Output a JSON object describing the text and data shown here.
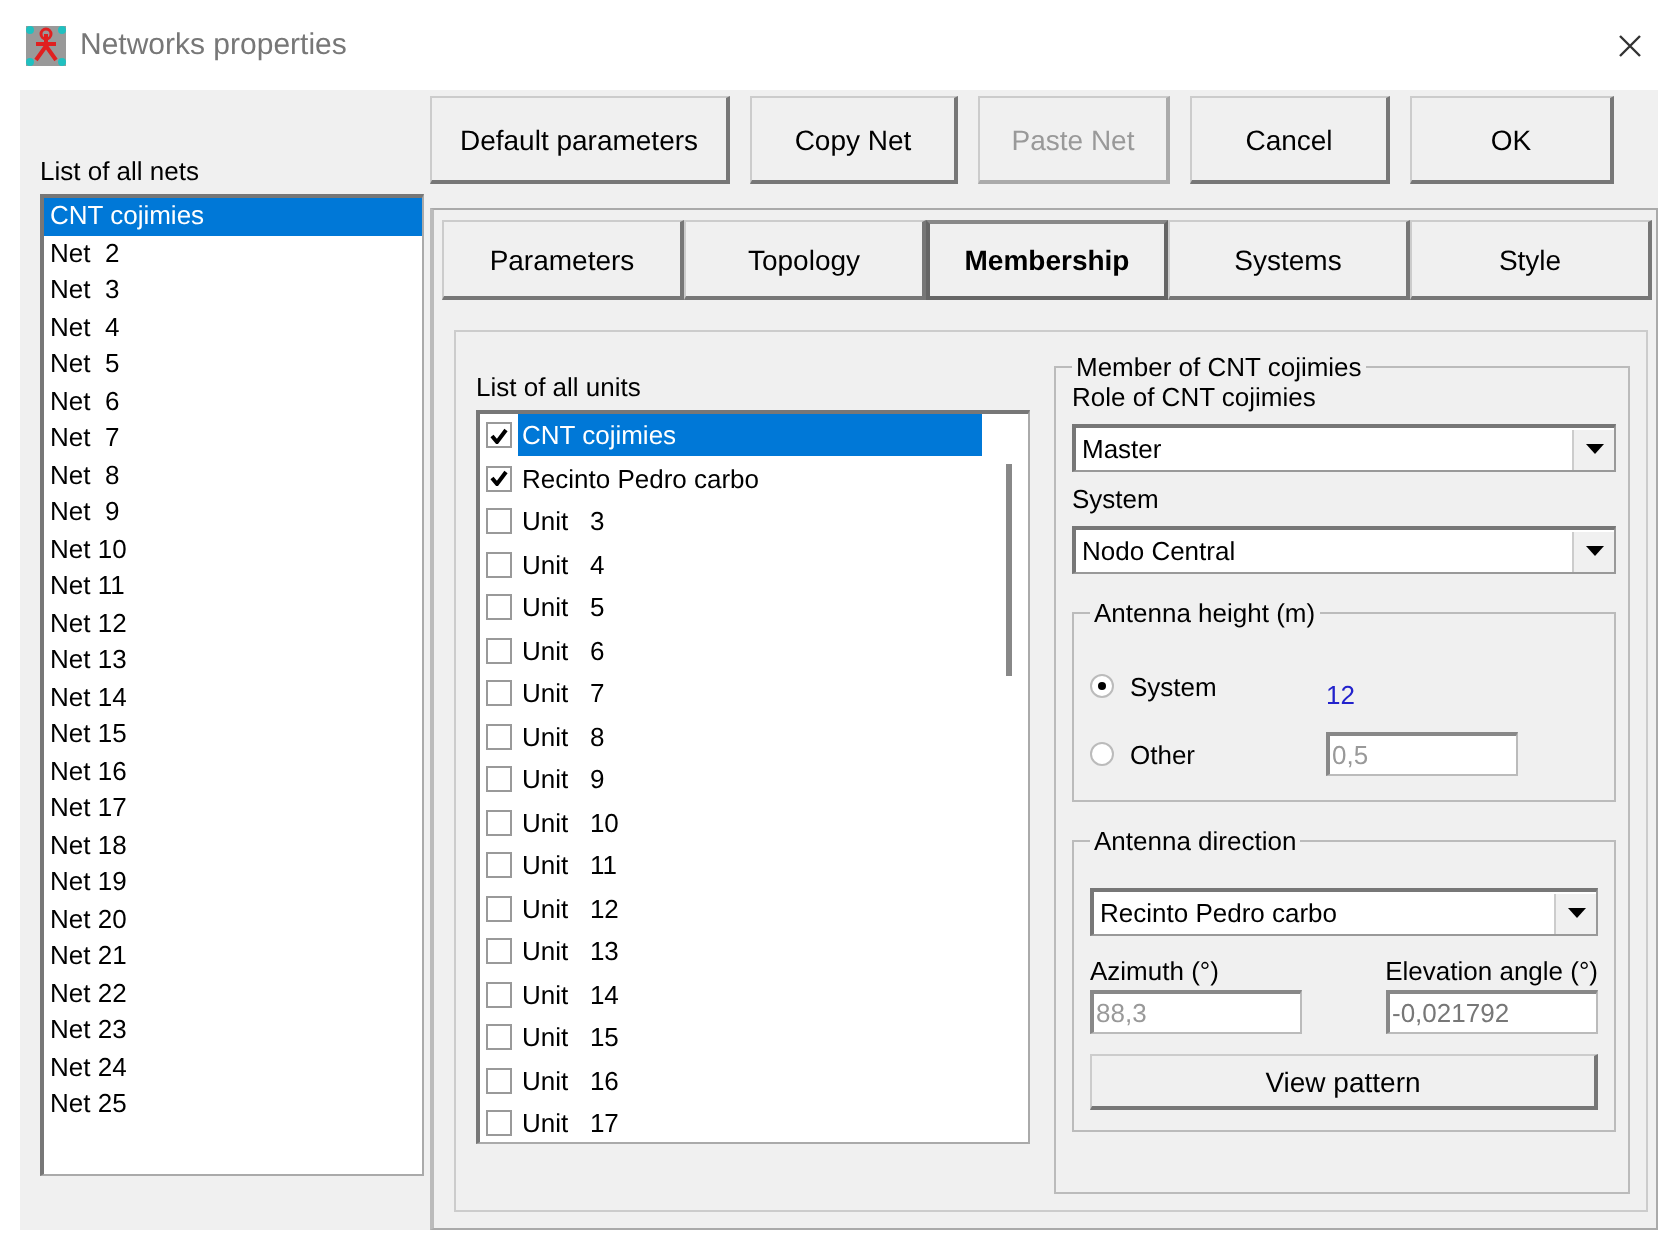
{
  "window": {
    "title": "Networks properties"
  },
  "buttons": [
    {
      "label": "Default parameters",
      "disabled": false
    },
    {
      "label": "Copy Net",
      "disabled": false
    },
    {
      "label": "Paste Net",
      "disabled": true
    },
    {
      "label": "Cancel",
      "disabled": false
    },
    {
      "label": "OK",
      "disabled": false
    }
  ],
  "nets": {
    "label": "List of all nets",
    "items": [
      {
        "label": "CNT cojimies",
        "selected": true
      },
      {
        "label": "Net  2",
        "selected": false
      },
      {
        "label": "Net  3",
        "selected": false
      },
      {
        "label": "Net  4",
        "selected": false
      },
      {
        "label": "Net  5",
        "selected": false
      },
      {
        "label": "Net  6",
        "selected": false
      },
      {
        "label": "Net  7",
        "selected": false
      },
      {
        "label": "Net  8",
        "selected": false
      },
      {
        "label": "Net  9",
        "selected": false
      },
      {
        "label": "Net 10",
        "selected": false
      },
      {
        "label": "Net 11",
        "selected": false
      },
      {
        "label": "Net 12",
        "selected": false
      },
      {
        "label": "Net 13",
        "selected": false
      },
      {
        "label": "Net 14",
        "selected": false
      },
      {
        "label": "Net 15",
        "selected": false
      },
      {
        "label": "Net 16",
        "selected": false
      },
      {
        "label": "Net 17",
        "selected": false
      },
      {
        "label": "Net 18",
        "selected": false
      },
      {
        "label": "Net 19",
        "selected": false
      },
      {
        "label": "Net 20",
        "selected": false
      },
      {
        "label": "Net 21",
        "selected": false
      },
      {
        "label": "Net 22",
        "selected": false
      },
      {
        "label": "Net 23",
        "selected": false
      },
      {
        "label": "Net 24",
        "selected": false
      },
      {
        "label": "Net 25",
        "selected": false
      }
    ]
  },
  "tabs": [
    {
      "label": "Parameters",
      "selected": false
    },
    {
      "label": "Topology",
      "selected": false
    },
    {
      "label": "Membership",
      "selected": true
    },
    {
      "label": "Systems",
      "selected": false
    },
    {
      "label": "Style",
      "selected": false
    }
  ],
  "units": {
    "label": "List of all units",
    "items": [
      {
        "label": "CNT cojimies",
        "checked": true,
        "selected": true
      },
      {
        "label": "Recinto Pedro carbo",
        "checked": true,
        "selected": false
      },
      {
        "label": "Unit   3",
        "checked": false,
        "selected": false
      },
      {
        "label": "Unit   4",
        "checked": false,
        "selected": false
      },
      {
        "label": "Unit   5",
        "checked": false,
        "selected": false
      },
      {
        "label": "Unit   6",
        "checked": false,
        "selected": false
      },
      {
        "label": "Unit   7",
        "checked": false,
        "selected": false
      },
      {
        "label": "Unit   8",
        "checked": false,
        "selected": false
      },
      {
        "label": "Unit   9",
        "checked": false,
        "selected": false
      },
      {
        "label": "Unit   10",
        "checked": false,
        "selected": false
      },
      {
        "label": "Unit   11",
        "checked": false,
        "selected": false
      },
      {
        "label": "Unit   12",
        "checked": false,
        "selected": false
      },
      {
        "label": "Unit   13",
        "checked": false,
        "selected": false
      },
      {
        "label": "Unit   14",
        "checked": false,
        "selected": false
      },
      {
        "label": "Unit   15",
        "checked": false,
        "selected": false
      },
      {
        "label": "Unit   16",
        "checked": false,
        "selected": false
      },
      {
        "label": "Unit   17",
        "checked": false,
        "selected": false
      }
    ]
  },
  "member": {
    "title": "Member of CNT cojimies",
    "role": {
      "label": "Role of CNT cojimies",
      "value": "Master"
    },
    "system": {
      "label": "System",
      "value": "Nodo Central"
    },
    "antenna_height": {
      "title": "Antenna height (m)",
      "options": [
        {
          "label": "System",
          "selected": true
        },
        {
          "label": "Other",
          "selected": false
        }
      ],
      "system_value": "12",
      "other_value": "0,5"
    },
    "antenna_direction": {
      "title": "Antenna direction",
      "value": "Recinto Pedro carbo",
      "azimuth": {
        "label": "Azimuth (°)",
        "value": "88,3"
      },
      "elevation": {
        "label": "Elevation angle (°)",
        "value": "-0,021792"
      },
      "button": "View pattern"
    }
  }
}
